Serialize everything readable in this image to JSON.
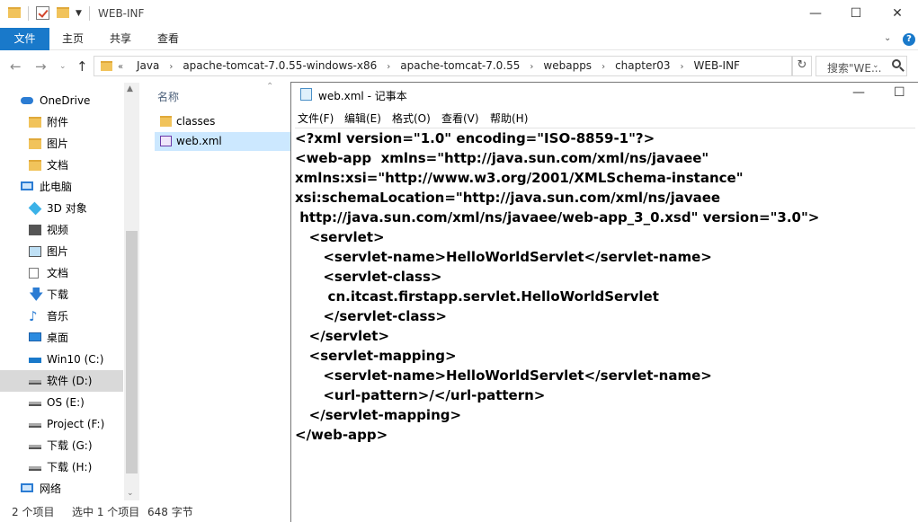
{
  "explorer": {
    "title": "WEB-INF",
    "ribbon_tabs": [
      "文件",
      "主页",
      "共享",
      "查看"
    ],
    "breadcrumbs": [
      "Java",
      "apache-tomcat-7.0.55-windows-x86",
      "apache-tomcat-7.0.55",
      "webapps",
      "chapter03",
      "WEB-INF"
    ],
    "breadcrumb_overflow": "«",
    "search_placeholder": "搜索\"WE...",
    "nav_items": [
      {
        "label": "OneDrive",
        "icon": "cloud-icon"
      },
      {
        "label": "附件",
        "icon": "folder-icon"
      },
      {
        "label": "图片",
        "icon": "folder-icon"
      },
      {
        "label": "文档",
        "icon": "folder-icon"
      },
      {
        "label": "此电脑",
        "icon": "computer-icon"
      },
      {
        "label": "3D 对象",
        "icon": "3d-objects-icon"
      },
      {
        "label": "视频",
        "icon": "video-icon"
      },
      {
        "label": "图片",
        "icon": "pictures-icon"
      },
      {
        "label": "文档",
        "icon": "documents-icon"
      },
      {
        "label": "下载",
        "icon": "download-icon"
      },
      {
        "label": "音乐",
        "icon": "music-icon"
      },
      {
        "label": "桌面",
        "icon": "desktop-icon"
      },
      {
        "label": "Win10 (C:)",
        "icon": "system-drive-icon"
      },
      {
        "label": "软件 (D:)",
        "icon": "drive-icon",
        "selected": true
      },
      {
        "label": "OS (E:)",
        "icon": "drive-icon"
      },
      {
        "label": "Project (F:)",
        "icon": "drive-icon"
      },
      {
        "label": "下载 (G:)",
        "icon": "drive-icon"
      },
      {
        "label": "下载 (H:)",
        "icon": "drive-icon"
      },
      {
        "label": "网络",
        "icon": "network-icon"
      }
    ],
    "column_header": "名称",
    "files": [
      {
        "name": "classes",
        "icon": "folder-icon"
      },
      {
        "name": "web.xml",
        "icon": "xml-file-icon",
        "selected": true
      }
    ],
    "status": {
      "count": "2 个项目",
      "selected": "选中 1 个项目",
      "size": "648 字节"
    }
  },
  "notepad": {
    "title": "web.xml - 记事本",
    "menu": [
      "文件(F)",
      "编辑(E)",
      "格式(O)",
      "查看(V)",
      "帮助(H)"
    ],
    "content": "<?xml version=\"1.0\" encoding=\"ISO-8859-1\"?>\n<web-app  xmlns=\"http://java.sun.com/xml/ns/javaee\"\nxmlns:xsi=\"http://www.w3.org/2001/XMLSchema-instance\"\nxsi:schemaLocation=\"http://java.sun.com/xml/ns/javaee\n http://java.sun.com/xml/ns/javaee/web-app_3_0.xsd\" version=\"3.0\">\n   <servlet>\n      <servlet-name>HelloWorldServlet</servlet-name>\n      <servlet-class>\n       cn.itcast.firstapp.servlet.HelloWorldServlet\n      </servlet-class>\n   </servlet>\n   <servlet-mapping>\n      <servlet-name>HelloWorldServlet</servlet-name>\n      <url-pattern>/</url-pattern>\n   </servlet-mapping>\n</web-app>"
  }
}
